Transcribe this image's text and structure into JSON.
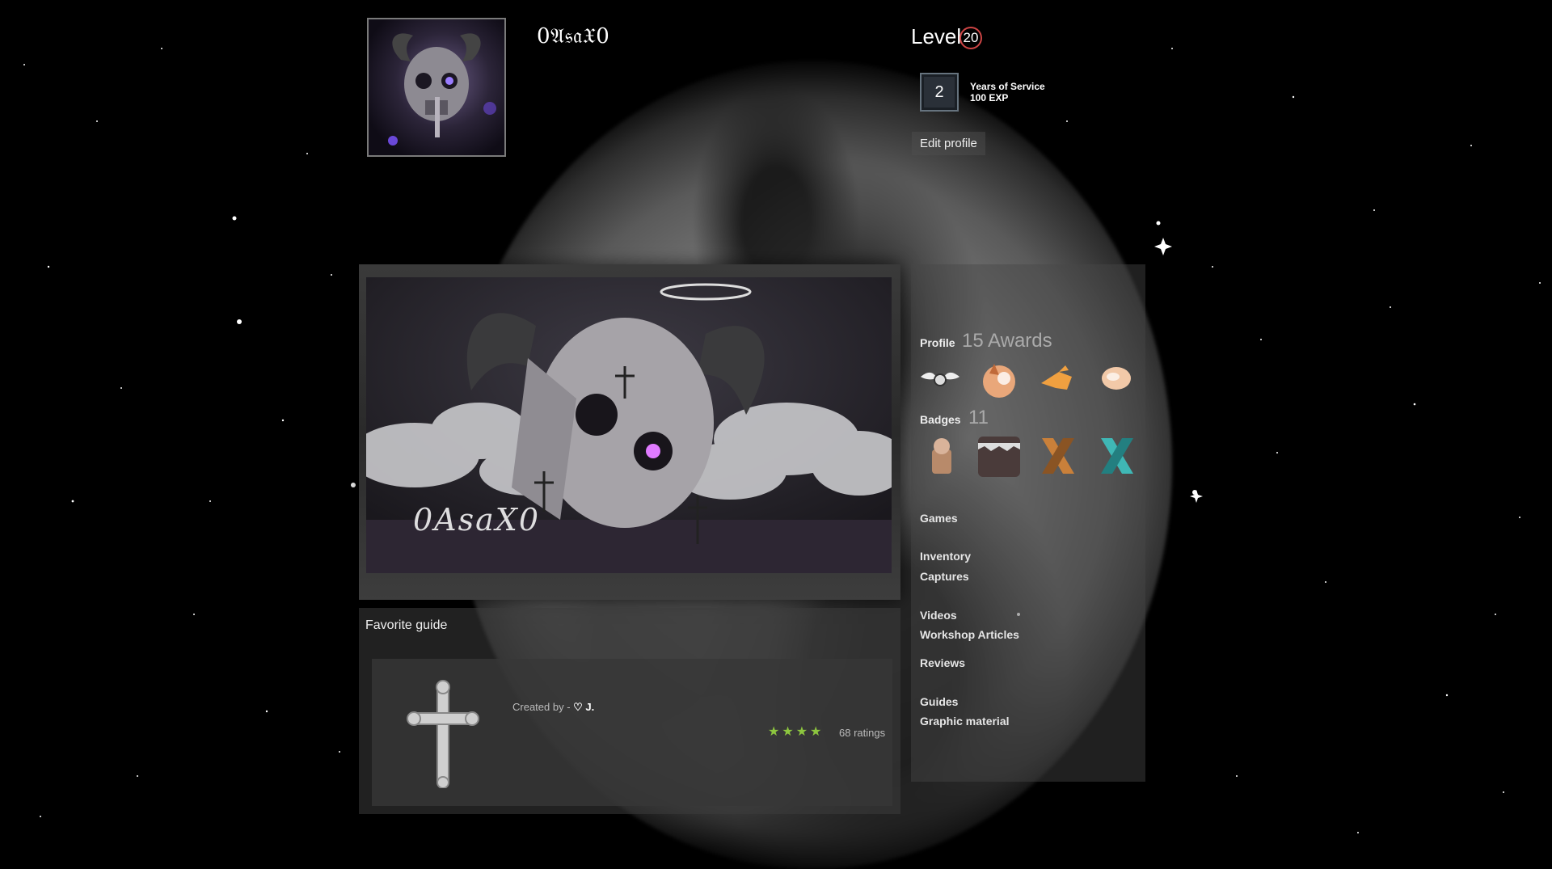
{
  "profile": {
    "username": "0𝔄𝔰𝔞𝔛0",
    "level_label": "Level",
    "level": "20",
    "service": {
      "years": "2",
      "title": "Years of Service",
      "exp": "100 EXP"
    },
    "edit_label": "Edit profile"
  },
  "showcase": {
    "art_signature": "0AsaX0"
  },
  "favorite_guide": {
    "heading": "Favorite guide",
    "created_by_prefix": "Created by - ",
    "creator": "♡ J.",
    "stars": "★★★★",
    "ratings": "68 ratings"
  },
  "sidebar": {
    "awards_label": "Profile",
    "awards_count": "15 Awards",
    "badges_label": "Badges",
    "badges_count": "11",
    "links": {
      "games": "Games",
      "inventory": "Inventory",
      "captures": "Captures",
      "videos": "Videos",
      "workshop": "Workshop Articles",
      "reviews": "Reviews",
      "guides": "Guides",
      "graphic": "Graphic material"
    }
  },
  "colors": {
    "level_ring": "#cc4444",
    "rating_stars": "#8dc63f"
  }
}
